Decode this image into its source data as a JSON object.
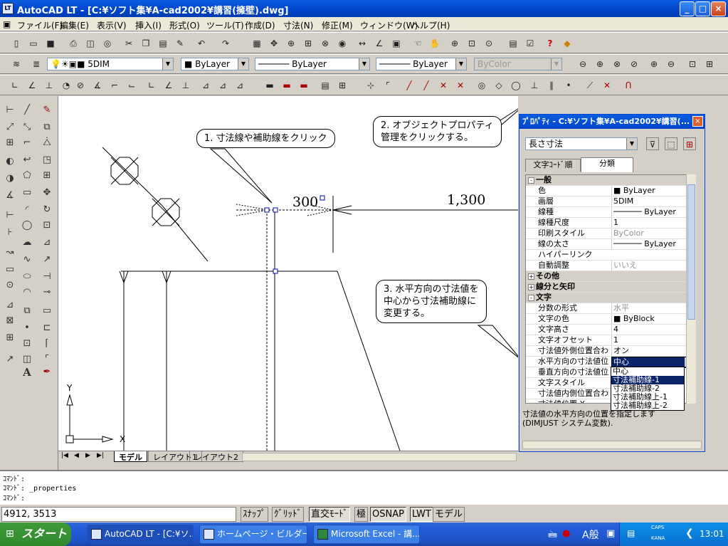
{
  "window": {
    "title": "AutoCAD LT - [C:¥ソフト集¥A-cad2002¥講習(擁壁).dwg]",
    "icon": "LT",
    "min_label": "_",
    "max_label": "□",
    "close_label": "×"
  },
  "menu": [
    "ファイル(F)",
    "編集(E)",
    "表示(V)",
    "挿入(I)",
    "形式(O)",
    "ツール(T)",
    "作成(D)",
    "寸法(N)",
    "修正(M)",
    "ウィンドウ(W)",
    "ヘルプ(H)"
  ],
  "layer_toolbar": {
    "layer": "5DIM",
    "color": "ByLayer",
    "linetype": "ByLayer",
    "lineweight": "ByLayer",
    "plotstyle": "ByColor"
  },
  "drawing": {
    "dim_value_a": "300",
    "dim_value_b": "1,300",
    "ucs_y": "Y",
    "ucs_x": "X"
  },
  "callouts": {
    "c1": "1. 寸法線や補助線をクリック",
    "c2_line1": "2. オブジェクトプロパティ",
    "c2_line2": "管理をクリックする。",
    "c3_line1": "3. 水平方向の寸法値を",
    "c3_line2": "中心から寸法補助線に",
    "c3_line3": "変更する。"
  },
  "layout_tabs": [
    "モデル",
    "レイアウト1",
    "レイアウト2"
  ],
  "properties": {
    "title": "ﾌﾟﾛﾊﾟﾃｨ - C:¥ソフト集¥A-cad2002¥講習(...",
    "object_type": "長さ寸法",
    "tabs": [
      "文字ｺｰﾄﾞ順",
      "分類"
    ],
    "rows": [
      {
        "type": "cat",
        "exp": "-",
        "label": "一般"
      },
      {
        "key": "色",
        "value": "ByLayer",
        "swatch": true
      },
      {
        "key": "画層",
        "value": "5DIM"
      },
      {
        "key": "線種",
        "value": "ByLayer",
        "line": true
      },
      {
        "key": "線種尺度",
        "value": "1"
      },
      {
        "key": "印刷スタイル",
        "value": "ByColor",
        "gray": true
      },
      {
        "key": "線の太さ",
        "value": "ByLayer",
        "line": true
      },
      {
        "key": "ハイパーリンク",
        "value": ""
      },
      {
        "key": "自動調整",
        "value": "いいえ",
        "gray": true
      },
      {
        "type": "cat",
        "exp": "+",
        "label": "その他"
      },
      {
        "type": "cat",
        "exp": "+",
        "label": "線分と矢印"
      },
      {
        "type": "cat",
        "exp": "-",
        "label": "文字"
      },
      {
        "key": "分数の形式",
        "value": "水平",
        "gray": true
      },
      {
        "key": "文字の色",
        "value": "ByBlock",
        "swatch": true
      },
      {
        "key": "文字高さ",
        "value": "4"
      },
      {
        "key": "文字オフセット",
        "value": "1"
      },
      {
        "key": "寸法値外側位置合わせ",
        "value": "オン"
      },
      {
        "key": "水平方向の寸法値位置",
        "value": "中心",
        "selected": true
      },
      {
        "key": "垂直方向の寸法値位置",
        "value": ""
      },
      {
        "key": "文字スタイル",
        "value": ""
      },
      {
        "key": "寸法値内側位置合わせ",
        "value": ""
      },
      {
        "key": "寸法値位置 X",
        "value": ""
      }
    ],
    "dropdown": [
      "中心",
      "寸法補助線-1",
      "寸法補助線-2",
      "寸法補助線上-1",
      "寸法補助線上-2"
    ],
    "description_line1": "寸法値の水平方向の位置を指定します",
    "description_line2": "(DIMJUST システム変数)."
  },
  "command": {
    "line1": "ｺﾏﾝﾄﾞ:",
    "line2": "ｺﾏﾝﾄﾞ: _properties",
    "line3": "ｺﾏﾝﾄﾞ:"
  },
  "status": {
    "coords": "4912, 3513",
    "buttons": [
      "ｽﾅｯﾌﾟ",
      "ｸﾞﾘｯﾄﾞ",
      "直交ﾓｰﾄﾞ",
      "極",
      "OSNAP",
      "LWT",
      "モデル"
    ]
  },
  "taskbar": {
    "start": "スタート",
    "tasks": [
      "AutoCAD LT - [C:¥ソ...",
      "ホームページ・ビルダー",
      "Microsoft Excel - 講..."
    ],
    "ime": "A般",
    "caps": "CAPS",
    "kana": "KANA",
    "clock": "13:01"
  }
}
